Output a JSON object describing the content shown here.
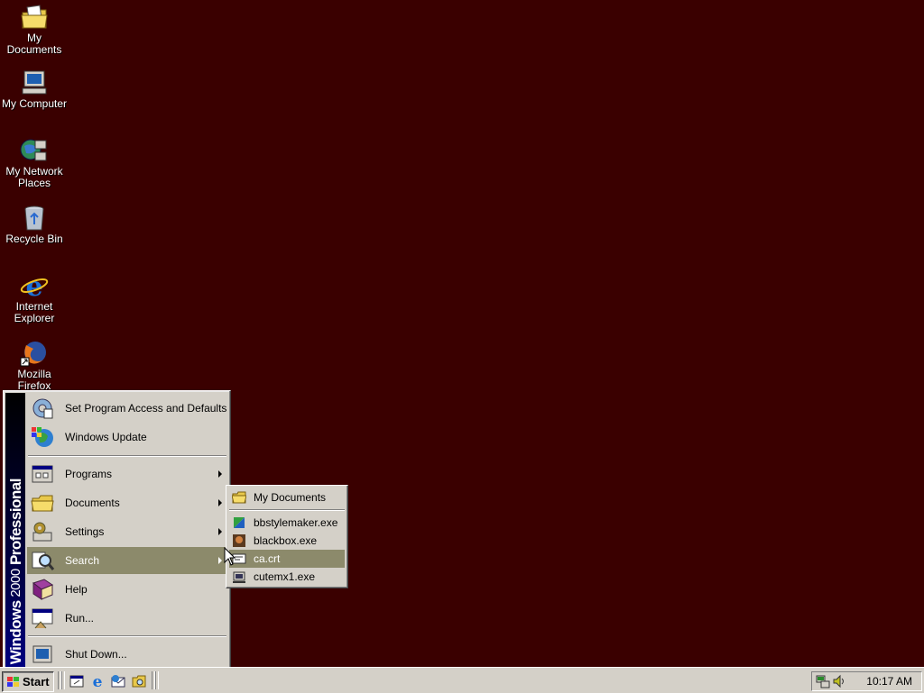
{
  "desktop": {
    "background": "#3a0000",
    "icons": [
      {
        "label": "My Documents",
        "icon": "my-documents-icon"
      },
      {
        "label": "My Computer",
        "icon": "my-computer-icon"
      },
      {
        "label": "My Network Places",
        "icon": "network-places-icon"
      },
      {
        "label": "Recycle Bin",
        "icon": "recycle-bin-icon"
      },
      {
        "label": "Internet Explorer",
        "icon": "internet-explorer-icon"
      },
      {
        "label": "Mozilla Firefox",
        "icon": "firefox-icon"
      }
    ]
  },
  "start_menu": {
    "banner_bold": "Windows",
    "banner_light": "2000",
    "banner_tail": "Professional",
    "items": [
      {
        "label": "Set Program Access and Defaults",
        "icon": "program-access-icon",
        "submenu": false
      },
      {
        "label": "Windows Update",
        "icon": "windows-update-icon",
        "submenu": false
      },
      {
        "label": "Programs",
        "icon": "programs-icon",
        "submenu": true
      },
      {
        "label": "Documents",
        "icon": "documents-folder-icon",
        "submenu": true
      },
      {
        "label": "Settings",
        "icon": "settings-icon",
        "submenu": true
      },
      {
        "label": "Search",
        "icon": "search-icon",
        "submenu": true,
        "highlighted": true
      },
      {
        "label": "Help",
        "icon": "help-book-icon",
        "submenu": false
      },
      {
        "label": "Run...",
        "icon": "run-icon",
        "submenu": false
      },
      {
        "label": "Shut Down...",
        "icon": "shutdown-icon",
        "submenu": false
      }
    ]
  },
  "documents_submenu": {
    "items": [
      {
        "label": "My Documents",
        "icon": "folder-icon"
      },
      {
        "label": "bbstylemaker.exe",
        "icon": "bbstylemaker-icon"
      },
      {
        "label": "blackbox.exe",
        "icon": "blackbox-icon"
      },
      {
        "label": "ca.crt",
        "icon": "certificate-icon",
        "highlighted": true
      },
      {
        "label": "cutemx1.exe",
        "icon": "cutemx-icon"
      }
    ]
  },
  "taskbar": {
    "start_label": "Start",
    "quick_launch": [
      "show-desktop-icon",
      "internet-explorer-icon",
      "outlook-express-icon",
      "explorer-icon"
    ],
    "tray_icons": [
      "network-tray-icon",
      "volume-tray-icon"
    ],
    "clock": "10:17 AM"
  },
  "colors": {
    "menu_face": "#d4d0c8",
    "highlight": "#8c8a6b",
    "banner": "#000080"
  }
}
